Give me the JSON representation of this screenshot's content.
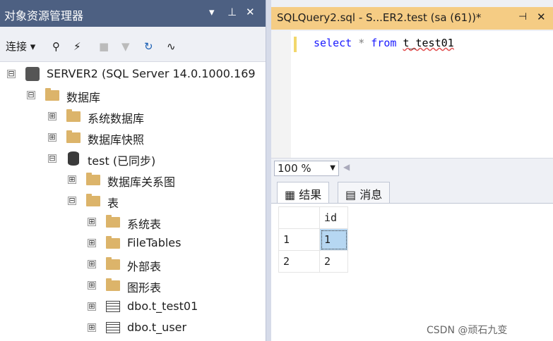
{
  "object_explorer": {
    "title": "对象资源管理器",
    "controls": [
      "▾",
      "⊥",
      "✕"
    ],
    "toolbar": {
      "connect": "连接",
      "icons": [
        "connect-icon",
        "disconnect-icon",
        "stop-icon",
        "filter-icon",
        "refresh-icon",
        "activity-monitor-icon"
      ]
    },
    "tree": [
      {
        "label": "SERVER2 (SQL Server 14.0.1000.169",
        "expander": "⊟",
        "icon": "server-icon"
      },
      {
        "label": "数据库",
        "expander": "⊟",
        "icon": "folder-icon"
      },
      {
        "label": "系统数据库",
        "expander": "⊞",
        "icon": "folder-icon"
      },
      {
        "label": "数据库快照",
        "expander": "⊞",
        "icon": "folder-icon"
      },
      {
        "label": "test (已同步)",
        "expander": "⊟",
        "icon": "database-icon"
      },
      {
        "label": "数据库关系图",
        "expander": "⊞",
        "icon": "folder-icon"
      },
      {
        "label": "表",
        "expander": "⊟",
        "icon": "folder-icon"
      },
      {
        "label": "系统表",
        "expander": "⊞",
        "icon": "folder-icon"
      },
      {
        "label": "FileTables",
        "expander": "⊞",
        "icon": "folder-icon"
      },
      {
        "label": "外部表",
        "expander": "⊞",
        "icon": "folder-icon"
      },
      {
        "label": "图形表",
        "expander": "⊞",
        "icon": "folder-icon"
      },
      {
        "label": "dbo.t_test01",
        "expander": "⊞",
        "icon": "table-icon"
      },
      {
        "label": "dbo.t_user",
        "expander": "⊞",
        "icon": "table-icon"
      }
    ]
  },
  "query": {
    "tab_title": "SQLQuery2.sql - S...ER2.test (sa (61))*",
    "tab_controls": [
      "⊣",
      "✕"
    ],
    "code": {
      "kw1": "select",
      "op": "*",
      "kw2": "from",
      "table": "t_test01"
    },
    "zoom": "100 %"
  },
  "results": {
    "tabs": [
      "结果",
      "消息"
    ],
    "columns": [
      "",
      "id"
    ],
    "rows": [
      [
        "1",
        "1"
      ],
      [
        "2",
        "2"
      ]
    ]
  },
  "watermark": "CSDN @顽石九变",
  "colors": {
    "title_bar": "#4d6082",
    "active_tab": "#f5cc84",
    "folder": "#dcb46a",
    "selected_cell": "#b6d7f2"
  }
}
